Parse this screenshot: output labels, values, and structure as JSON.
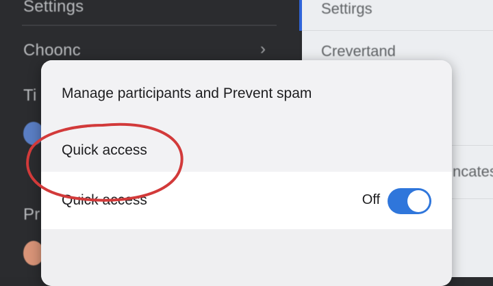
{
  "sidebar": {
    "items": [
      {
        "label": "Settings"
      },
      {
        "label": "Choonc"
      },
      {
        "label": "Ti"
      },
      {
        "label": "Pr"
      }
    ]
  },
  "right_panel": {
    "items": [
      {
        "label": "Settirgs"
      },
      {
        "label": "Crevertand"
      },
      {
        "label": "ncates"
      }
    ]
  },
  "sheet": {
    "manage_label": "Manage participants and Prevent spam",
    "quick_access_label": "Quick access",
    "toggle_row_label": "Quick access",
    "toggle_state_label": "Off"
  },
  "colors": {
    "toggle_on": "#2f76db",
    "annotation": "#d23a3a",
    "selected_edge": "#2f64d8"
  }
}
